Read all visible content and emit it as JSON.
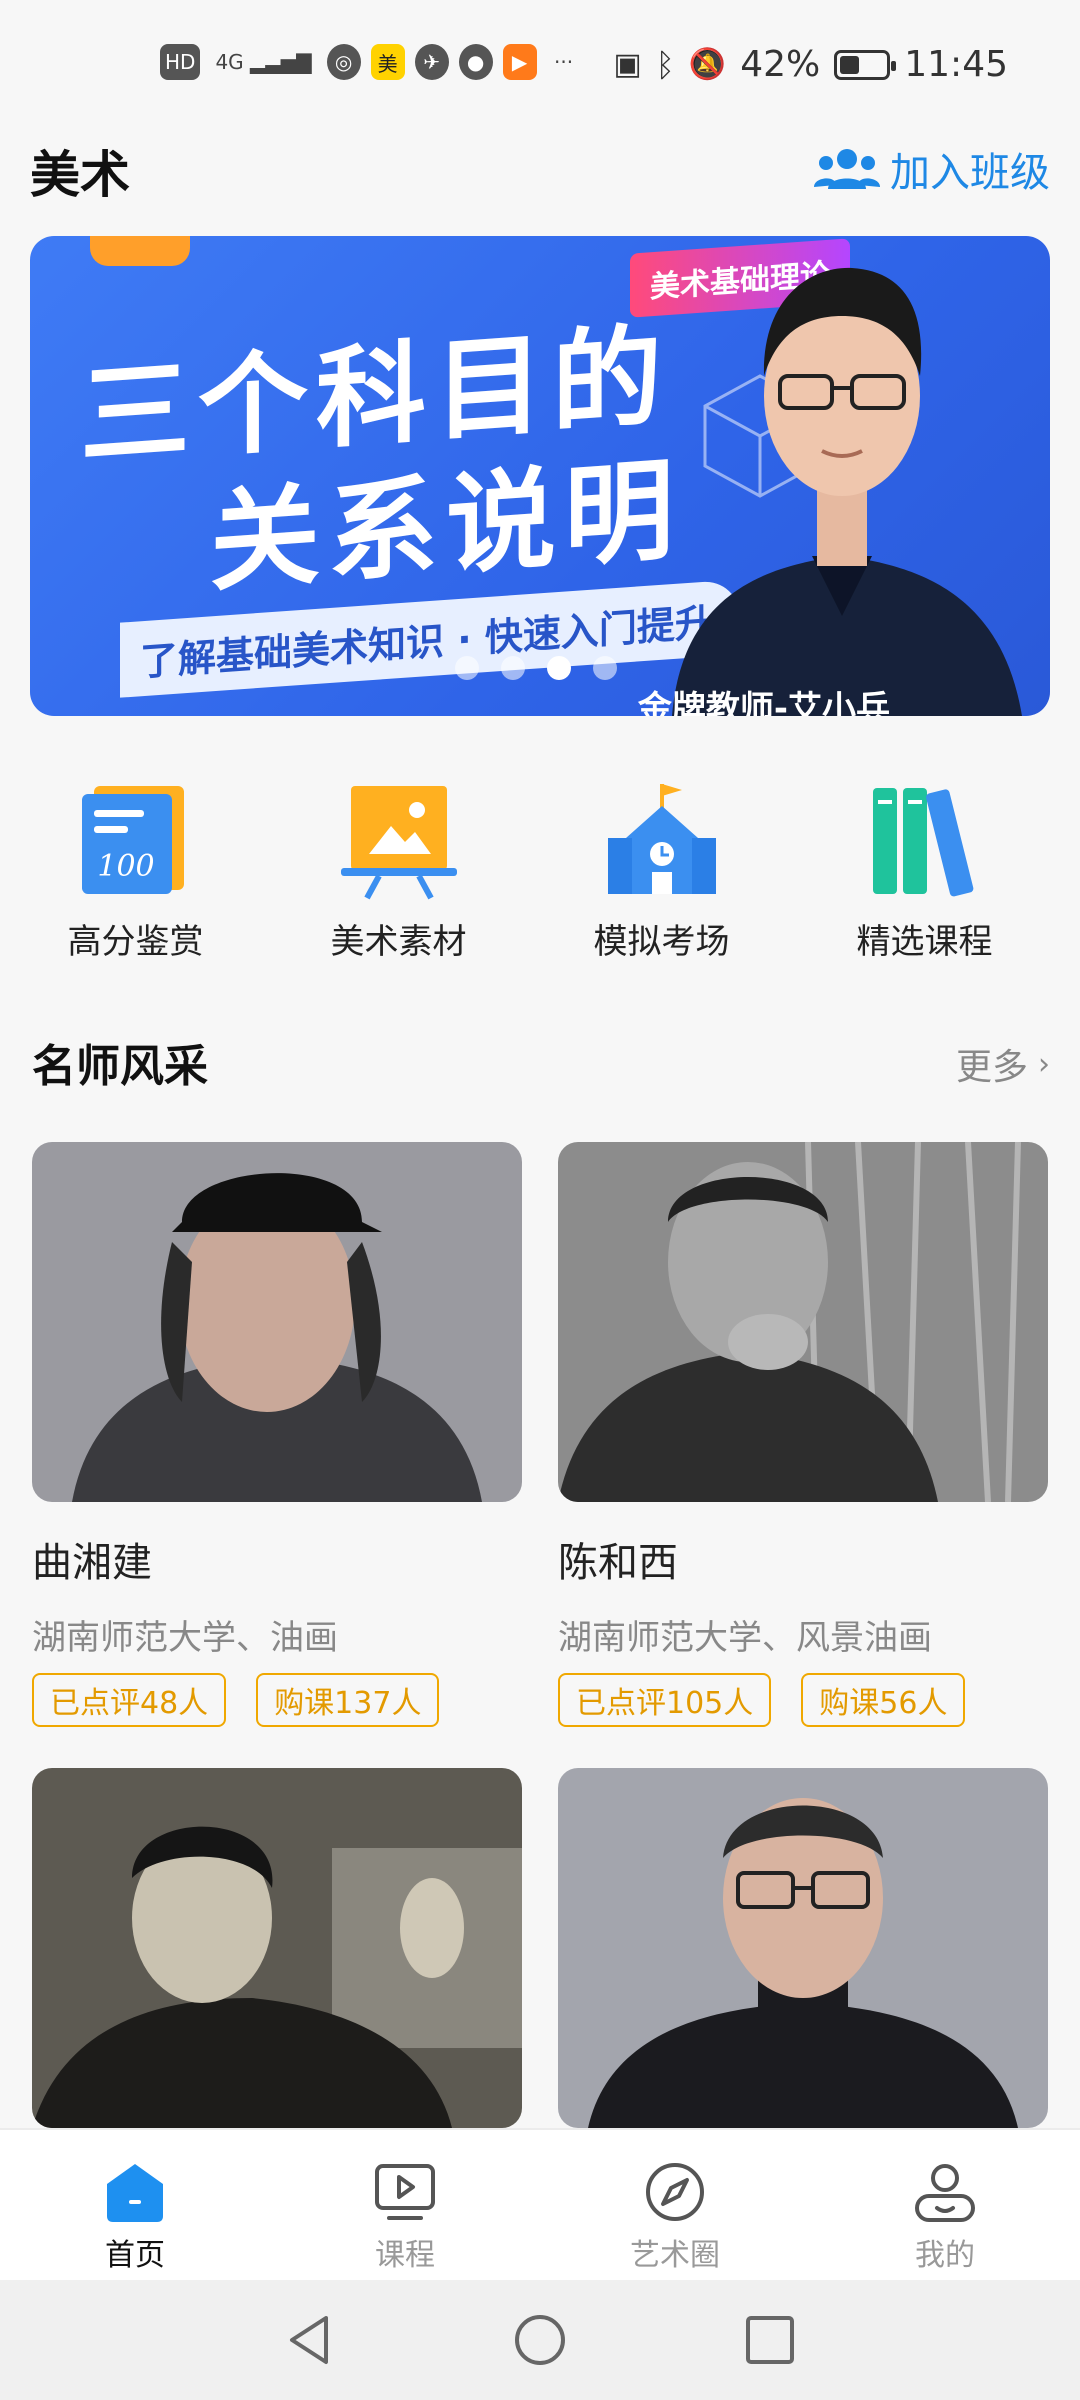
{
  "status_bar": {
    "left_icons": [
      "HD",
      "4G",
      "美",
      "▶",
      "···"
    ],
    "battery_text": "42%",
    "battery_level": 0.42,
    "time": "11:45"
  },
  "header": {
    "title": "美术",
    "join_label": "加入班级"
  },
  "banner": {
    "badge": "美术基础理论",
    "headline_line1": "三个科目的",
    "headline_line2": "关系说明",
    "tagline": "了解基础美术知识 · 快速入门提升",
    "caption": "金牌教师-艾小兵",
    "slide_count": 4,
    "active_index": 2
  },
  "quick_entries": [
    {
      "label": "高分鉴赏",
      "icon": "score-book-icon"
    },
    {
      "label": "美术素材",
      "icon": "easel-picture-icon"
    },
    {
      "label": "模拟考场",
      "icon": "school-building-icon"
    },
    {
      "label": "精选课程",
      "icon": "books-icon"
    }
  ],
  "section": {
    "title": "名师风采",
    "more_label": "更多"
  },
  "teachers": [
    {
      "name": "曲湘建",
      "desc": "湖南师范大学、油画",
      "reviewed": "已点评48人",
      "purchased": "购课137人"
    },
    {
      "name": "陈和西",
      "desc": "湖南师范大学、风景油画",
      "reviewed": "已点评105人",
      "purchased": "购课56人"
    },
    {
      "name": "",
      "desc": "",
      "reviewed": "",
      "purchased": ""
    },
    {
      "name": "",
      "desc": "",
      "reviewed": "",
      "purchased": ""
    }
  ],
  "bottom_nav": [
    {
      "label": "首页",
      "icon": "home-icon",
      "active": true
    },
    {
      "label": "课程",
      "icon": "video-course-icon",
      "active": false
    },
    {
      "label": "艺术圈",
      "icon": "compass-icon",
      "active": false
    },
    {
      "label": "我的",
      "icon": "user-profile-icon",
      "active": false
    }
  ],
  "colors": {
    "accent_blue": "#1e88e5",
    "tag_orange": "#e39a00",
    "banner_blue": "#3f7bf5"
  }
}
